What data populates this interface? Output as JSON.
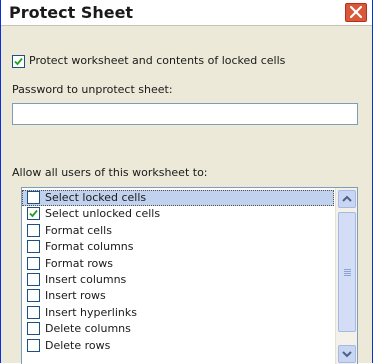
{
  "window": {
    "title": "Protect Sheet",
    "close_icon": "close-x-icon"
  },
  "protect_option": {
    "label": "Protect worksheet and contents of locked cells",
    "checked": true
  },
  "password": {
    "label": "Password to unprotect sheet:",
    "value": ""
  },
  "allow_section": {
    "label": "Allow all users of this worksheet to:"
  },
  "permissions": [
    {
      "label": "Select locked cells",
      "checked": false,
      "selected": true
    },
    {
      "label": "Select unlocked cells",
      "checked": true,
      "selected": false
    },
    {
      "label": "Format cells",
      "checked": false,
      "selected": false
    },
    {
      "label": "Format columns",
      "checked": false,
      "selected": false
    },
    {
      "label": "Format rows",
      "checked": false,
      "selected": false
    },
    {
      "label": "Insert columns",
      "checked": false,
      "selected": false
    },
    {
      "label": "Insert rows",
      "checked": false,
      "selected": false
    },
    {
      "label": "Insert hyperlinks",
      "checked": false,
      "selected": false
    },
    {
      "label": "Delete columns",
      "checked": false,
      "selected": false
    },
    {
      "label": "Delete rows",
      "checked": false,
      "selected": false
    }
  ],
  "colors": {
    "selection": "#c1d2ee",
    "close_button": "#d9583a",
    "dialog_bg": "#ece9d8"
  }
}
